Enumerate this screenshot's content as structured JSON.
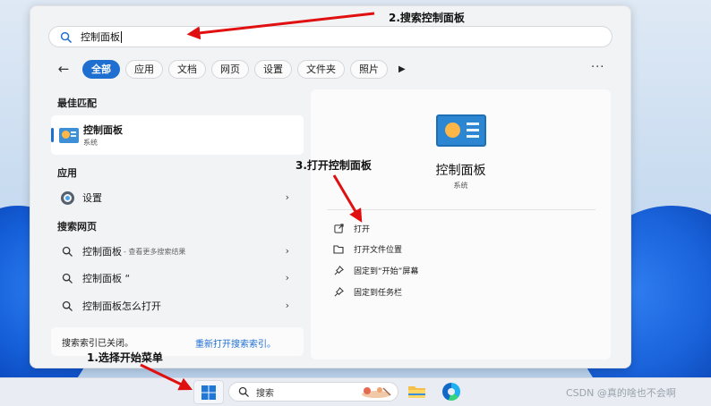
{
  "search": {
    "query": "控制面板"
  },
  "filters": {
    "back": "←",
    "chips": [
      "全部",
      "应用",
      "文档",
      "网页",
      "设置",
      "文件夹",
      "照片"
    ],
    "active": "全部",
    "more": "···"
  },
  "left": {
    "best_match_heading": "最佳匹配",
    "best_match": {
      "title": "控制面板",
      "subtitle": "系统"
    },
    "apps_heading": "应用",
    "apps": [
      {
        "label": "设置"
      }
    ],
    "web_heading": "搜索网页",
    "web": [
      {
        "label": "控制面板",
        "suffix": " - 查看更多搜索结果"
      },
      {
        "label": "控制面板 “",
        "suffix": ""
      },
      {
        "label": "控制面板怎么打开",
        "suffix": ""
      }
    ],
    "index_notice": "搜索索引已关闭。",
    "index_link": "重新打开搜索索引。"
  },
  "right": {
    "title": "控制面板",
    "subtitle": "系统",
    "actions": [
      {
        "label": "打开",
        "icon": "open-external-icon"
      },
      {
        "label": "打开文件位置",
        "icon": "folder-icon"
      },
      {
        "label": "固定到“开始”屏幕",
        "icon": "pin-icon"
      },
      {
        "label": "固定到任务栏",
        "icon": "pin-icon"
      }
    ]
  },
  "annotations": {
    "step1": "1.选择开始菜单",
    "step2": "2.搜索控制面板",
    "step3": "3.打开控制面板",
    "color": "#e01010"
  },
  "taskbar": {
    "search_placeholder": "搜索"
  },
  "watermark": "CSDN @真的啥也不会啊"
}
